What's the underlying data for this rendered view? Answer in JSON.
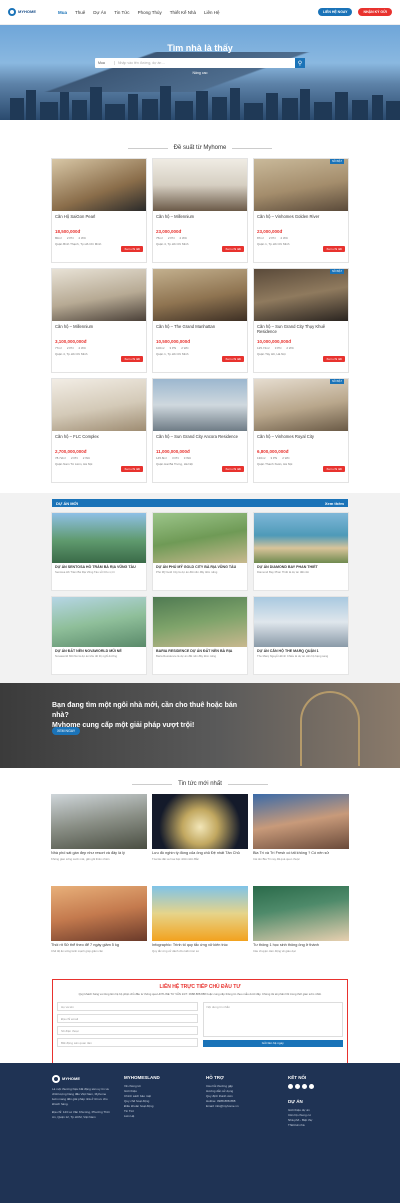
{
  "header": {
    "logo_text": "MYHOME",
    "nav": [
      "Mua",
      "Thuê",
      "Dự Án",
      "Tin Tức",
      "Phong Thủy",
      "Thiết Kế Nhà",
      "Liên Hệ"
    ],
    "btn_contact": "LIÊN HỆ NGAY",
    "btn_deposit": "NHẬN KÝ GỬI"
  },
  "hero": {
    "title": "Tìm nhà là thấy",
    "search_select": "Mua",
    "search_placeholder": "Nhập vào tên đường, dự án ...",
    "advanced": "Nâng cao"
  },
  "suggest": {
    "title": "Đề suất từ Myhome",
    "cards": [
      {
        "name": "Căn Hộ SaiGon Pearl",
        "price": "18,500,000đ",
        "meta": [
          "80m²",
          "2 PN",
          "2 WC"
        ],
        "loc": "Quận Bình Thạnh, Tp.Hồ Chí Minh",
        "badge": ""
      },
      {
        "name": "Căn hộ – Millennium",
        "price": "23,000,000đ",
        "meta": [
          "75m²",
          "2 PN",
          "2 WC"
        ],
        "loc": "Quận 4, Tp.Hồ Chí Minh",
        "badge": ""
      },
      {
        "name": "Căn hộ – Vinhomes Golden River",
        "price": "23,000,000đ",
        "meta": [
          "87m²",
          "2 PN",
          "2 WC"
        ],
        "loc": "Quận 1, Tp.Hồ Chí Minh",
        "badge": "NỔI BẬT"
      },
      {
        "name": "Căn hộ – Millennium",
        "price": "3,100,000,000đ",
        "meta": [
          "77m²",
          "2 PN",
          "2 WC"
        ],
        "loc": "Quận 4, Tp.Hồ Chí Minh",
        "badge": ""
      },
      {
        "name": "Căn hộ – The Grand Manhattan",
        "price": "10,500,000,000đ",
        "meta": [
          "100m²",
          "3 PN",
          "2 WC"
        ],
        "loc": "Quận 1, Tp.Hồ Chí Minh",
        "badge": ""
      },
      {
        "name": "Căn hộ – Sun Grand City Thụy Khuê Residence",
        "price": "10,000,000,000đ",
        "meta": [
          "125.74m²",
          "3 PN",
          "2 WC"
        ],
        "loc": "Quận Tây Hồ, Hà Nội",
        "badge": "NỔI BẬT"
      },
      {
        "name": "Căn hộ – FLC Complex",
        "price": "2,700,000,000đ",
        "meta": [
          "78.72m²",
          "2 PN",
          "2 WC"
        ],
        "loc": "Quận Nam Từ Liêm, Hà Nội",
        "badge": ""
      },
      {
        "name": "Căn hộ – Sun Grand City Ancora Residence",
        "price": "11,000,000,000đ",
        "meta": [
          "145.8m²",
          "3 PN",
          "3 WC"
        ],
        "loc": "Quận Hai Bà Trưng, Hà Nội",
        "badge": ""
      },
      {
        "name": "Căn hộ – Vinhomes Royal City",
        "price": "6,800,000,000đ",
        "meta": [
          "130m²",
          "3 PN",
          "2 WC"
        ],
        "loc": "Quận Thanh Xuân, Hà Nội",
        "badge": "NỔI BẬT"
      }
    ],
    "detail_btn": "Xem chi tiết"
  },
  "projects": {
    "title": "DỰ ÁN MỚI",
    "more": "Xem thêm",
    "items": [
      {
        "name": "DỰ ÁN SENTOSA HỒ TRÀM BÀ RỊA VŨNG TÀU",
        "desc": "Sentosa Hồ Tràm Bà Rịa Vũng Tàu sở hữu vị trí"
      },
      {
        "name": "DỰ ÁN PHÚ MỸ GOLD CITY BÀ RỊA VŨNG TÀU",
        "desc": "Phú Mỹ Gold City là dự án đất nền đầy tiềm năng"
      },
      {
        "name": "DỰ ÁN DIAMOND BAY PHAN THIẾT",
        "desc": "Diamond Bay Phan Thiết là dự án đất nền"
      },
      {
        "name": "DỰ ÁN ĐẤT NỀN NOVAWORLD MŨI NÉ",
        "desc": "Novaworld Mũi Né là dự án khu đô thị nghỉ dưỡng"
      },
      {
        "name": "BARIA RESIDENCE DỰ ÁN ĐẤT NỀN BÀ RỊA",
        "desc": "Baria Residence là dự án đất nền đầy tiềm năng"
      },
      {
        "name": "DỰ ÁN CĂN HỘ THE MARQ QUẬN 1",
        "desc": "The Marq Nguyễn Đình Chiểu là dự án căn hộ hạng sang"
      }
    ]
  },
  "cta": {
    "line1": "Bạn đang tìm một ngôi nhà mới, cần cho thuê hoặc bán nhà?",
    "line2": "Myhome cung cấp một giải pháp vượt trội!",
    "btn": "XEM NGAY"
  },
  "news": {
    "title": "Tin tức mới nhất",
    "items": [
      {
        "title": "Nhà phố sát gần đẹp như resort và đây là lý",
        "desc": "Không gian sống xanh mát, gần gũi thiên nhiên"
      },
      {
        "title": "Lưu đồ nghìn tỷ đồng của ông chủ Đệ nhất Tân Chủ",
        "desc": "Tòa lâu đài xa hoa bậc nhất miền Bắc"
      },
      {
        "title": "Bia Trí và Trí Fresh có tất không ? Có nên sử",
        "desc": "Cái tên Bia Trí nay đã quá quen thuộc"
      },
      {
        "title": "Thói rít Sữ thể theo để 7 ngày giảm 5 kg",
        "desc": "Chế độ ăn uống lành mạnh giúp giảm cân"
      },
      {
        "title": "Infographic: Trình tố quy tắc ứng xử kiến trúc",
        "desc": "Quy tắc ứng xử dành cho kiến trúc sư"
      },
      {
        "title": "Tư thông 1 học sinh thông ông ở thành",
        "desc": "Câu chuyện cảm động về giáo dục"
      }
    ]
  },
  "contact": {
    "title": "LIÊN HỆ TRỰC TIẾP CHỦ ĐẦU TƯ",
    "desc": "Quý khách hàng vui lòng liên hệ bộ phận chủ đầu tư thông qua HOTLINE TƯ VẤN 24/7: 0988.888.888 hoặc cung cấp thông tin theo mẫu dưới đây. Chúng tôi sẽ phản hồi trong thời gian sớm nhất.",
    "name_ph": "Họ và tên",
    "email_ph": "Địa chỉ email",
    "phone_ph": "Số điện thoại",
    "select": "Bất động sản quan tâm",
    "msg_ph": "Nội dung tin nhắn",
    "submit": "Gửi liên hệ ngay"
  },
  "footer": {
    "about": "Là một thương hiệu bất động sản uy tín và chất lượng hàng đầu Việt Nam, Myhome luôn mang đến giải pháp nhà ở tối ưu cho khách hàng.",
    "address": "Địa chỉ: 123 Lê Văn Khương, Phường Thới An, Quận 12, Tp.HCM, Việt Nam",
    "col1_title": "MYHOMESLAND",
    "col1": [
      "Về chúng tôi",
      "Giới thiệu",
      "Chính sách bảo mật",
      "Quy chế hoạt động",
      "Điều khoản hoạt động",
      "Tin Tức",
      "Liên Hệ"
    ],
    "col2_title": "HỖ TRỢ",
    "col2": [
      "Câu hỏi thường gặp",
      "Hướng dẫn sử dụng",
      "Quy định thành viên",
      "Hotline: 0988.888.888",
      "Email: info@myhome.vn"
    ],
    "col3_title": "KẾT NỐI",
    "col4_title": "DỰ ÁN",
    "col4": [
      "Giới thiệu dự án",
      "Căn hộ chung cư",
      "Nhà phố - Biệt thự",
      "Thiết kế nhà"
    ]
  }
}
